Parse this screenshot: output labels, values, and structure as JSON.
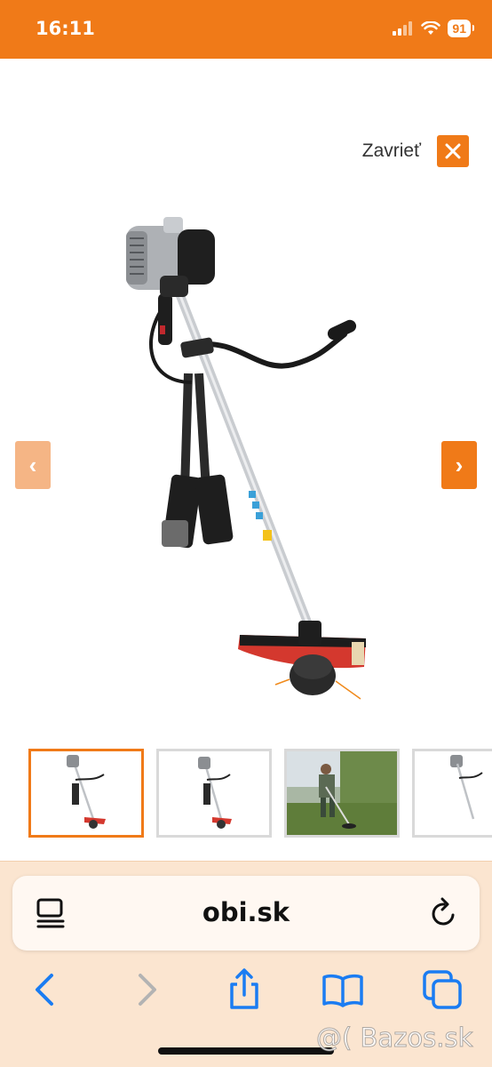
{
  "status_bar": {
    "time": "16:11",
    "battery": "91",
    "background_color": "#f07a18",
    "icons": [
      "cellular-signal-icon",
      "wifi-icon",
      "battery-icon"
    ]
  },
  "gallery": {
    "close_label": "Zavrieť",
    "close_icon": "close-icon",
    "prev_arrow": "‹",
    "next_arrow": "›",
    "main_image": "brush-cutter-product-image",
    "thumbnails": [
      {
        "image": "brush-cutter-thumbnail",
        "active": true
      },
      {
        "image": "brush-cutter-thumbnail",
        "active": false
      },
      {
        "image": "person-using-brush-cutter-photo",
        "active": false
      },
      {
        "image": "brush-cutter-thumbnail-partial",
        "active": false
      }
    ],
    "accent_color": "#f07a18"
  },
  "browser": {
    "url": "obi.sk",
    "left_icon": "reader-mode-icon",
    "right_icon": "reload-icon",
    "toolbar": [
      "back-icon",
      "forward-icon",
      "share-icon",
      "bookmarks-icon",
      "tabs-icon"
    ],
    "background_color": "#fbe5d0"
  },
  "watermark": "@( Bazos.sk"
}
